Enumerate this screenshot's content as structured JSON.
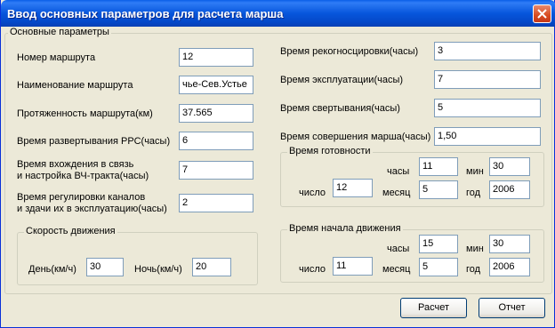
{
  "window": {
    "title": "Ввод основных параметров для расчета марша"
  },
  "main_group": {
    "legend": "Основные параметры"
  },
  "left": {
    "route_number": {
      "label": "Номер маршрута",
      "value": "12"
    },
    "route_name": {
      "label": "Наименование маршрута",
      "value": "чье-Сев.Устье"
    },
    "route_length": {
      "label": "Протяженность маршрута(км)",
      "value": "37.565"
    },
    "rrs_deploy_time": {
      "label": "Время развертывания РРС(часы)",
      "value": "6"
    },
    "comm_entry_time": {
      "label_line1": "Время вхождения в связь",
      "label_line2": "и настройка ВЧ-тракта(часы)",
      "value": "7"
    },
    "channel_adjust_time": {
      "label_line1": "Время регулировки каналов",
      "label_line2": "и здачи их в эксплуатацию(часы)",
      "value": "2"
    }
  },
  "speed": {
    "legend": "Скорость движения",
    "day_label": "День(км/ч)",
    "day_value": "30",
    "night_label": "Ночь(км/ч)",
    "night_value": "20"
  },
  "right": {
    "recon_time": {
      "label": "Время рекогносцировки(часы)",
      "value": "3"
    },
    "operation_time": {
      "label": "Время эксплуатации(часы)",
      "value": "7"
    },
    "teardown_time": {
      "label": "Время свертывания(часы)",
      "value": "5"
    },
    "march_time": {
      "label": "Время совершения марша(часы)",
      "value": "1,50"
    }
  },
  "readiness": {
    "legend": "Время готовности",
    "hours_label": "часы",
    "hours": "11",
    "min_label": "мин",
    "min": "30",
    "day_label": "число",
    "day": "12",
    "month_label": "месяц",
    "month": "5",
    "year_label": "год",
    "year": "2006"
  },
  "start": {
    "legend": "Время начала движения",
    "hours_label": "часы",
    "hours": "15",
    "min_label": "мин",
    "min": "30",
    "day_label": "число",
    "day": "11",
    "month_label": "месяц",
    "month": "5",
    "year_label": "год",
    "year": "2006"
  },
  "buttons": {
    "calc": "Расчет",
    "report": "Отчет"
  },
  "colors": {
    "titlebar": "#0756dc",
    "face": "#ece9d8",
    "close": "#d84b1f"
  }
}
